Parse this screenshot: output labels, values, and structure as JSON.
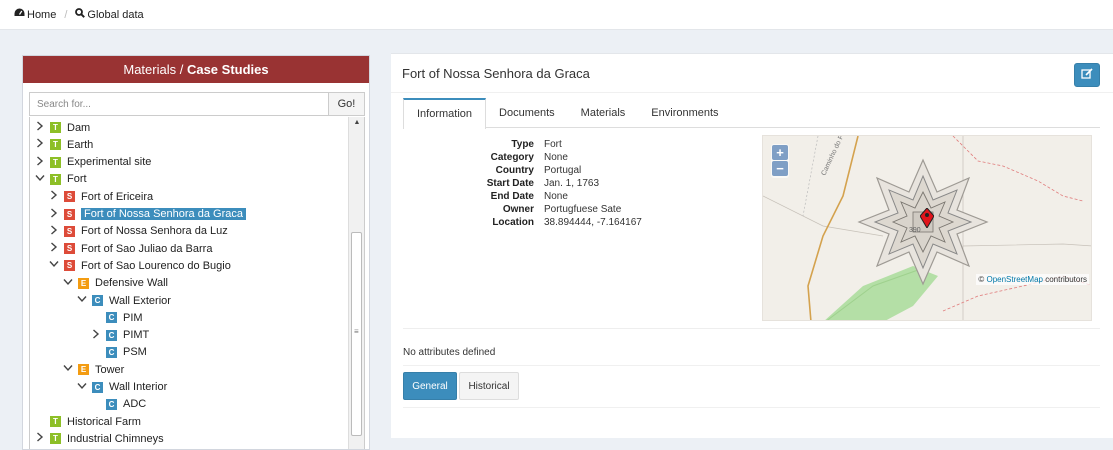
{
  "breadcrumb": {
    "home_label": "Home",
    "global_label": "Global data"
  },
  "left_panel": {
    "title_part1": "Materials / ",
    "title_part2": "Case Studies",
    "search_placeholder": "Search for...",
    "go_label": "Go!",
    "tree": [
      {
        "label": "Dam",
        "badge": "T",
        "caret": "right",
        "level": 0
      },
      {
        "label": "Earth",
        "badge": "T",
        "caret": "right",
        "level": 0
      },
      {
        "label": "Experimental site",
        "badge": "T",
        "caret": "right",
        "level": 0
      },
      {
        "label": "Fort",
        "badge": "T",
        "caret": "down",
        "level": 0
      },
      {
        "label": "Fort of Ericeira",
        "badge": "S",
        "caret": "right",
        "level": 1
      },
      {
        "label": "Fort of Nossa Senhora da Graca",
        "badge": "S",
        "caret": "right",
        "level": 1,
        "selected": true
      },
      {
        "label": "Fort of Nossa Senhora da Luz",
        "badge": "S",
        "caret": "right",
        "level": 1
      },
      {
        "label": "Fort of Sao Juliao da Barra",
        "badge": "S",
        "caret": "right",
        "level": 1
      },
      {
        "label": "Fort of Sao Lourenco do Bugio",
        "badge": "S",
        "caret": "down",
        "level": 1
      },
      {
        "label": "Defensive Wall",
        "badge": "E",
        "caret": "down",
        "level": 2
      },
      {
        "label": "Wall Exterior",
        "badge": "C",
        "caret": "down",
        "level": 3
      },
      {
        "label": "PIM",
        "badge": "C",
        "caret": "none",
        "level": 4
      },
      {
        "label": "PIMT",
        "badge": "C",
        "caret": "right",
        "level": 4
      },
      {
        "label": "PSM",
        "badge": "C",
        "caret": "none",
        "level": 4
      },
      {
        "label": "Tower",
        "badge": "E",
        "caret": "down",
        "level": 2
      },
      {
        "label": "Wall Interior",
        "badge": "C",
        "caret": "down",
        "level": 3
      },
      {
        "label": "ADC",
        "badge": "C",
        "caret": "none",
        "level": 4
      },
      {
        "label": "Historical Farm",
        "badge": "T",
        "caret": "none",
        "level": 0
      },
      {
        "label": "Industrial Chimneys",
        "badge": "T",
        "caret": "right",
        "level": 0
      }
    ]
  },
  "detail": {
    "title": "Fort of Nossa Senhora da Graca",
    "tabs": [
      "Information",
      "Documents",
      "Materials",
      "Environments"
    ],
    "info": [
      {
        "key": "Type",
        "value": "Fort"
      },
      {
        "key": "Category",
        "value": "None"
      },
      {
        "key": "Country",
        "value": "Portugal"
      },
      {
        "key": "Start Date",
        "value": "Jan. 1, 1763"
      },
      {
        "key": "End Date",
        "value": "None"
      },
      {
        "key": "Owner",
        "value": "Portugfuese Sate"
      },
      {
        "key": "Location",
        "value": "38.894444, -7.164167"
      }
    ],
    "map": {
      "zoom_in": "+",
      "zoom_out": "−",
      "attribution_symbol": "©",
      "attribution_link": "OpenStreetMap",
      "attribution_rest": "contributors",
      "road_label": "Caminho do Forte",
      "elevation_label": "390"
    },
    "no_attributes": "No attributes defined",
    "buttons": {
      "general": "General",
      "historical": "Historical"
    }
  },
  "colors": {
    "header_red": "#993333",
    "primary_blue": "#3c8dbc",
    "badge_T": "#8dbf27",
    "badge_S": "#dd4b39",
    "badge_E": "#f39c12",
    "badge_C": "#3c8dbc"
  }
}
